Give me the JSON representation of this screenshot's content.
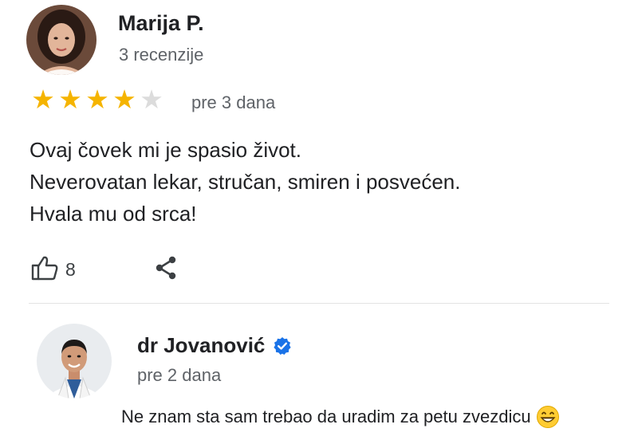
{
  "review": {
    "author": "Marija P.",
    "review_count": "3 recenzije",
    "rating": 4,
    "rating_max": 5,
    "date": "pre 3 dana",
    "text_lines": [
      "Ovaj čovek mi je spasio život.",
      "Neverovatan lekar, stručan, smiren i posvećen.",
      "Hvala mu od srca!"
    ],
    "likes": "8",
    "like_icon": "thumbs-up-icon",
    "share_icon": "share-icon",
    "star_color": "#f5b400"
  },
  "reply": {
    "author": "dr Jovanović",
    "verified_icon": "verified-badge-icon",
    "verified_color": "#1a73e8",
    "date": "pre 2 dana",
    "text": "Ne znam sta sam trebao da uradim za petu zvezdicu",
    "emoji": "grinning-face-icon"
  }
}
